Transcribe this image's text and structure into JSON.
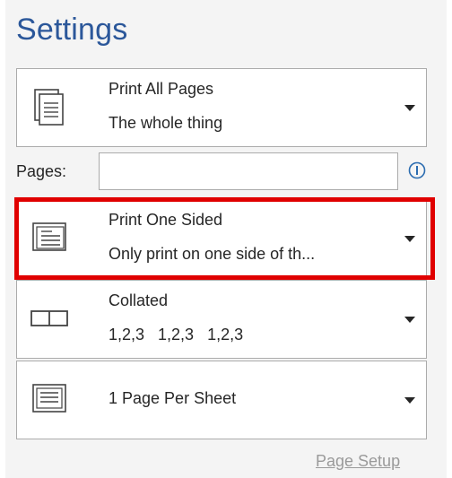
{
  "settings": {
    "title": "Settings"
  },
  "print_pages": {
    "title": "Print All Pages",
    "subtitle": "The whole thing"
  },
  "pages": {
    "label": "Pages:",
    "value": "",
    "placeholder": ""
  },
  "sides": {
    "title": "Print One Sided",
    "subtitle": "Only print on one side of th..."
  },
  "collation": {
    "title": "Collated",
    "subtitle": "1,2,3   1,2,3   1,2,3"
  },
  "pages_per_sheet": {
    "title": "1 Page Per Sheet"
  },
  "links": {
    "page_setup": "Page Setup"
  },
  "colors": {
    "accent": "#2b579a",
    "highlight": "#e00000",
    "info": "#2b6cb0"
  },
  "icons": {
    "print_pages": "document-pages-icon",
    "sides": "one-sided-icon",
    "collation": "collated-icon",
    "pages_per_sheet": "page-per-sheet-icon",
    "info": "info-icon",
    "dropdown": "chevron-down-icon"
  }
}
